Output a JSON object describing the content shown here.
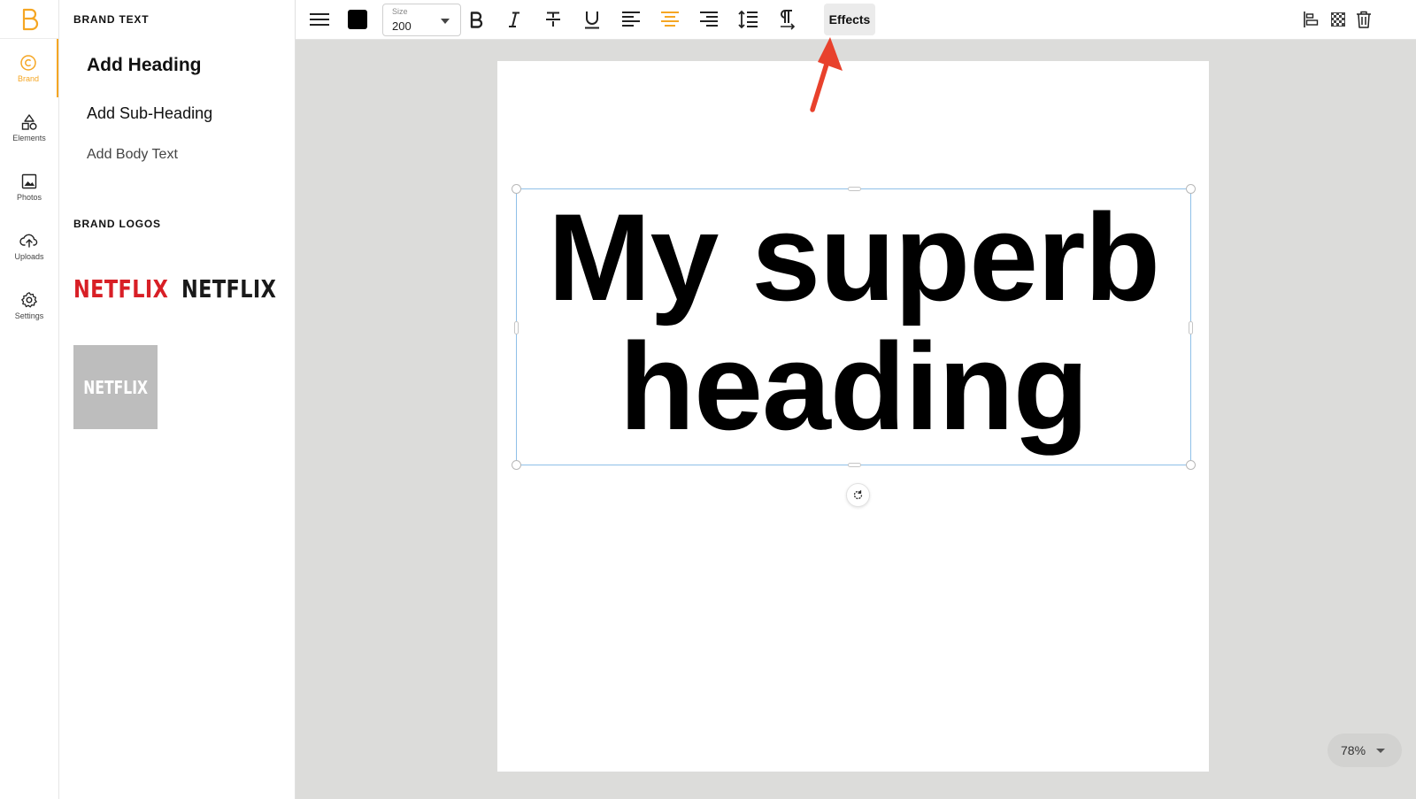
{
  "sidebar": {
    "logo": "brand-logo",
    "items": [
      {
        "label": "Brand",
        "icon": "copyright-icon",
        "active": true
      },
      {
        "label": "Elements",
        "icon": "shapes-icon",
        "active": false
      },
      {
        "label": "Photos",
        "icon": "image-icon",
        "active": false
      },
      {
        "label": "Uploads",
        "icon": "cloud-upload-icon",
        "active": false
      },
      {
        "label": "Settings",
        "icon": "gear-icon",
        "active": false
      }
    ]
  },
  "panel": {
    "brand_text_title": "BRAND TEXT",
    "add_heading": "Add Heading",
    "add_subheading": "Add Sub-Heading",
    "add_body": "Add Body Text",
    "brand_logos_title": "BRAND LOGOS",
    "logos": [
      "NETFLIX",
      "NETFLIX",
      "NETFLIX"
    ]
  },
  "toolbar": {
    "size_caption": "Size",
    "size_value": "200",
    "effects_label": "Effects",
    "text_color": "#000000",
    "active_alignment": "center",
    "accent_color": "#f5a623",
    "icons": [
      "menu-icon",
      "color-swatch",
      "bold-icon",
      "italic-icon",
      "strikethrough-icon",
      "underline-icon",
      "align-left-icon",
      "align-center-icon",
      "align-right-icon",
      "line-height-icon",
      "paragraph-icon",
      "position-icon",
      "transparency-icon",
      "trash-icon"
    ]
  },
  "canvas": {
    "heading_line1": "My superb",
    "heading_line2": "heading",
    "zoom": "78%"
  },
  "colors": {
    "annotation_arrow": "#e8412c",
    "selection_border": "#8fc0e8"
  }
}
